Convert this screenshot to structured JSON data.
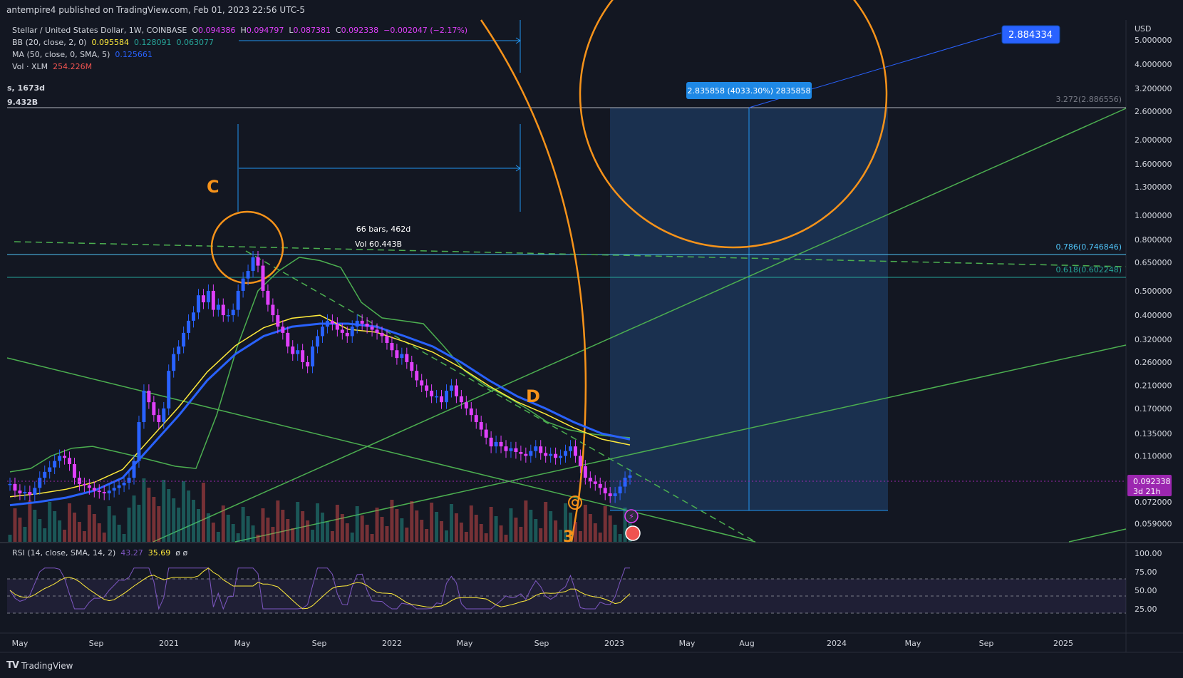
{
  "header": {
    "publish_line": "antempire4 published on TradingView.com, Feb 01, 2023 22:56 UTC-5"
  },
  "legend": {
    "symbol": "Stellar / United States Dollar, 1W, COINBASE",
    "o_label": "O",
    "o": "0.094386",
    "h_label": "H",
    "h": "0.094797",
    "l_label": "L",
    "l": "0.087381",
    "c_label": "C",
    "c": "0.092338",
    "chg": "−0.002047 (−2.17%)",
    "bb_label": "BB (20, close, 2, 0)",
    "bb_basis": "0.095584",
    "bb_upper": "0.128091",
    "bb_lower": "0.063077",
    "ma_label": "MA (50, close, 0, SMA, 5)",
    "ma_value": "0.125661",
    "vol_label": "Vol · XLM",
    "vol_value": "254.226M"
  },
  "side_labels": {
    "duration": "s, 1673d",
    "volume": "9.432B"
  },
  "measure": {
    "bars": "66 bars, 462d",
    "vol": "Vol 60.443B"
  },
  "target": {
    "label": "2.835858 (4033.30%) 2835858",
    "price_tag": "2.884334"
  },
  "annotations": {
    "c": "C",
    "d": "D",
    "three": "3"
  },
  "fib": {
    "fib1": "3.272(2.886556)",
    "fib2": "0.786(0.746846)",
    "fib3": "0.618(0.602248)"
  },
  "price_axis": {
    "currency": "USD",
    "ticks": [
      "5.000000",
      "4.000000",
      "3.200000",
      "2.600000",
      "2.000000",
      "1.600000",
      "1.300000",
      "1.000000",
      "0.800000",
      "0.650000",
      "0.500000",
      "0.400000",
      "0.320000",
      "0.260000",
      "0.210000",
      "0.170000",
      "0.135000",
      "0.110000",
      "0.072000",
      "0.059000"
    ],
    "last_price": "0.092338",
    "countdown": "3d 21h"
  },
  "rsi": {
    "label": "RSI (14, close, SMA, 14, 2)",
    "value": "43.27",
    "sma": "35.69",
    "extra": "ø ø",
    "ticks": [
      "100.00",
      "75.00",
      "50.00",
      "25.00"
    ]
  },
  "time_axis": {
    "labels": [
      "May",
      "Sep",
      "2021",
      "May",
      "Sep",
      "2022",
      "May",
      "Sep",
      "2023",
      "May",
      "Aug",
      "2024",
      "May",
      "Sep",
      "2025"
    ]
  },
  "footer": {
    "brand": "TradingView"
  },
  "colors": {
    "bg": "#131722",
    "up": "#2962ff",
    "down": "#e040fb",
    "bb": "#4caf50",
    "ma": "#2962ff",
    "basis": "#ffeb3b",
    "orange": "#f7931a",
    "box": "#1e3a5f",
    "rsi": "#7e57c2"
  },
  "chart_data": {
    "type": "candlestick",
    "symbol": "XLM/USD",
    "interval": "1W",
    "scale": "log",
    "ylim": [
      0.05,
      6.0
    ],
    "yticks": [
      5.0,
      4.0,
      3.2,
      2.6,
      2.0,
      1.6,
      1.3,
      1.0,
      0.8,
      0.65,
      0.5,
      0.4,
      0.32,
      0.26,
      0.21,
      0.17,
      0.135,
      0.11,
      0.072,
      0.059
    ],
    "approx_close_series": [
      0.085,
      0.08,
      0.078,
      0.079,
      0.077,
      0.082,
      0.09,
      0.095,
      0.099,
      0.105,
      0.11,
      0.108,
      0.102,
      0.09,
      0.085,
      0.084,
      0.082,
      0.08,
      0.079,
      0.078,
      0.08,
      0.082,
      0.084,
      0.086,
      0.09,
      0.105,
      0.15,
      0.2,
      0.18,
      0.16,
      0.15,
      0.17,
      0.24,
      0.28,
      0.3,
      0.34,
      0.38,
      0.41,
      0.48,
      0.45,
      0.5,
      0.42,
      0.44,
      0.4,
      0.4,
      0.42,
      0.5,
      0.56,
      0.6,
      0.68,
      0.63,
      0.5,
      0.44,
      0.4,
      0.36,
      0.34,
      0.3,
      0.28,
      0.29,
      0.26,
      0.25,
      0.3,
      0.33,
      0.36,
      0.38,
      0.37,
      0.35,
      0.34,
      0.33,
      0.36,
      0.38,
      0.37,
      0.36,
      0.35,
      0.34,
      0.33,
      0.31,
      0.29,
      0.27,
      0.28,
      0.26,
      0.24,
      0.22,
      0.21,
      0.2,
      0.19,
      0.19,
      0.18,
      0.2,
      0.21,
      0.19,
      0.18,
      0.17,
      0.16,
      0.15,
      0.14,
      0.13,
      0.12,
      0.125,
      0.12,
      0.115,
      0.118,
      0.114,
      0.112,
      0.11,
      0.115,
      0.12,
      0.113,
      0.11,
      0.112,
      0.108,
      0.11,
      0.115,
      0.12,
      0.11,
      0.1,
      0.09,
      0.087,
      0.085,
      0.082,
      0.078,
      0.076,
      0.078,
      0.083,
      0.09,
      0.092
    ],
    "bb_upper_approx": [
      0.095,
      0.098,
      0.11,
      0.118,
      0.12,
      0.115,
      0.11,
      0.105,
      0.1,
      0.098,
      0.16,
      0.3,
      0.5,
      0.6,
      0.68,
      0.66,
      0.62,
      0.45,
      0.39,
      0.38,
      0.37,
      0.3,
      0.24,
      0.21,
      0.19,
      0.17,
      0.15,
      0.14,
      0.135,
      0.132,
      0.13
    ],
    "ma50_approx": [
      0.07,
      0.072,
      0.075,
      0.08,
      0.09,
      0.12,
      0.16,
      0.22,
      0.28,
      0.33,
      0.36,
      0.37,
      0.37,
      0.36,
      0.33,
      0.3,
      0.26,
      0.22,
      0.19,
      0.17,
      0.15,
      0.135,
      0.128
    ],
    "fib_levels": [
      {
        "ratio": "3.272",
        "price": 2.886556
      },
      {
        "ratio": "0.786",
        "price": 0.746846
      },
      {
        "ratio": "0.618",
        "price": 0.602248
      }
    ],
    "projection": {
      "from": 0.072,
      "to": 2.884334,
      "change_pct": "4033.30%"
    },
    "rsi": {
      "value": 43.27,
      "sma": 35.69,
      "ylim": [
        0,
        100
      ],
      "levels": [
        70,
        50,
        30
      ]
    },
    "volume_last": "254.226M"
  }
}
